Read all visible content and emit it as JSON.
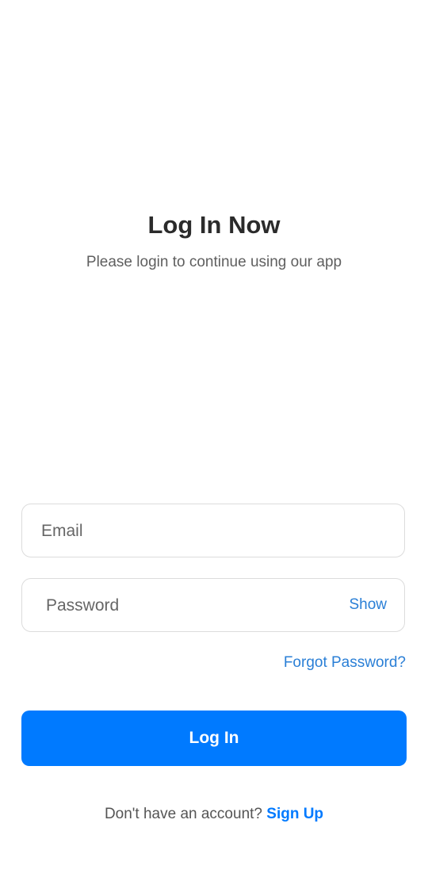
{
  "header": {
    "title": "Log In Now",
    "subtitle": "Please login to continue using our app"
  },
  "form": {
    "email_placeholder": "Email",
    "email_value": "",
    "password_placeholder": "Password",
    "password_value": "",
    "show_label": "Show",
    "forgot_label": "Forgot Password?",
    "login_label": "Log In"
  },
  "footer": {
    "prompt": "Don't have an account?",
    "signup_label": "Sign Up"
  },
  "colors": {
    "accent": "#007aff",
    "link": "#2a7fd6"
  }
}
